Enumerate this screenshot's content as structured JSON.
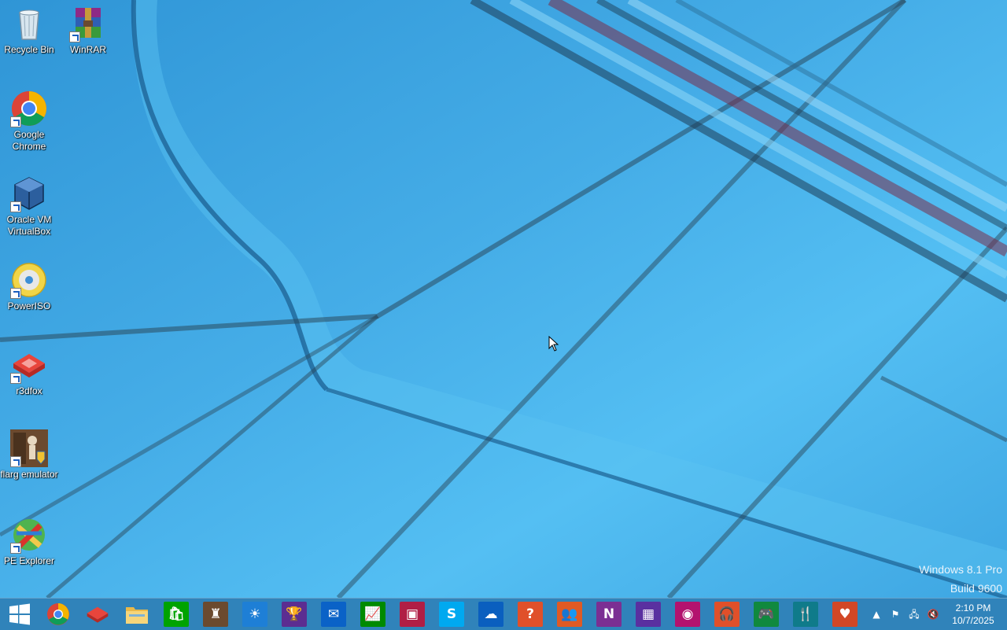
{
  "desktop": {
    "icons": [
      {
        "label": "Recycle Bin",
        "icon": "recycle-bin-icon",
        "shortcut": false
      },
      {
        "label": "WinRAR",
        "icon": "winrar-icon",
        "shortcut": true
      },
      {
        "label": "Google Chrome",
        "icon": "chrome-icon",
        "shortcut": true
      },
      {
        "label": "Oracle VM VirtualBox",
        "icon": "virtualbox-icon",
        "shortcut": true
      },
      {
        "label": "PowerISO",
        "icon": "poweriso-icon",
        "shortcut": true
      },
      {
        "label": "r3dfox",
        "icon": "r3dfox-icon",
        "shortcut": true
      },
      {
        "label": "flarg emulator",
        "icon": "flarg-emulator-icon",
        "shortcut": true
      },
      {
        "label": "PE Explorer",
        "icon": "pe-explorer-icon",
        "shortcut": true
      }
    ],
    "watermark": {
      "edition": "Windows 8.1 Pro",
      "build": "Build 9600"
    }
  },
  "taskbar": {
    "start_icon": "windows-start-icon",
    "apps": [
      {
        "name": "Google Chrome",
        "icon": "chrome-icon",
        "color": "#ffffff"
      },
      {
        "name": "r3dfox",
        "icon": "r3dfox-icon",
        "color": "#d9342b"
      },
      {
        "name": "File Explorer",
        "icon": "folder-icon",
        "color": "#f2c94c"
      },
      {
        "name": "Store",
        "icon": "store-icon",
        "color": "#00a300"
      },
      {
        "name": "flarg emulator",
        "icon": "flarg-emulator-icon",
        "color": "#6b4a2f"
      },
      {
        "name": "Weather",
        "icon": "sun-icon",
        "color": "#1e7fd6"
      },
      {
        "name": "Sports",
        "icon": "trophy-icon",
        "color": "#5c2d91"
      },
      {
        "name": "Mail",
        "icon": "mail-icon",
        "color": "#0a62c7"
      },
      {
        "name": "Finance",
        "icon": "chart-icon",
        "color": "#008a00"
      },
      {
        "name": "News",
        "icon": "news-icon",
        "color": "#b01e45"
      },
      {
        "name": "Skype",
        "icon": "skype-icon",
        "color": "#00a9f0"
      },
      {
        "name": "OneDrive",
        "icon": "cloud-icon",
        "color": "#0a5fbf"
      },
      {
        "name": "Help + Tips",
        "icon": "help-icon",
        "color": "#e0502a"
      },
      {
        "name": "People",
        "icon": "people-icon",
        "color": "#e05a24"
      },
      {
        "name": "OneNote",
        "icon": "onenote-icon",
        "color": "#7b2f93"
      },
      {
        "name": "Calendar",
        "icon": "calendar-icon",
        "color": "#5a30a0"
      },
      {
        "name": "Camera",
        "icon": "camera-icon",
        "color": "#b3126e"
      },
      {
        "name": "Music",
        "icon": "headphones-icon",
        "color": "#e0502a"
      },
      {
        "name": "Games",
        "icon": "gamepad-icon",
        "color": "#10893e"
      },
      {
        "name": "Food & Drink",
        "icon": "fork-knife-icon",
        "color": "#0f7b8a"
      },
      {
        "name": "Health & Fitness",
        "icon": "heart-icon",
        "color": "#d24726"
      }
    ],
    "tray": {
      "icons": [
        "show-hidden-icons-icon",
        "action-center-flag-icon",
        "network-icon",
        "volume-muted-icon"
      ]
    },
    "clock": {
      "time": "2:10 PM",
      "date": "10/7/2025"
    }
  }
}
